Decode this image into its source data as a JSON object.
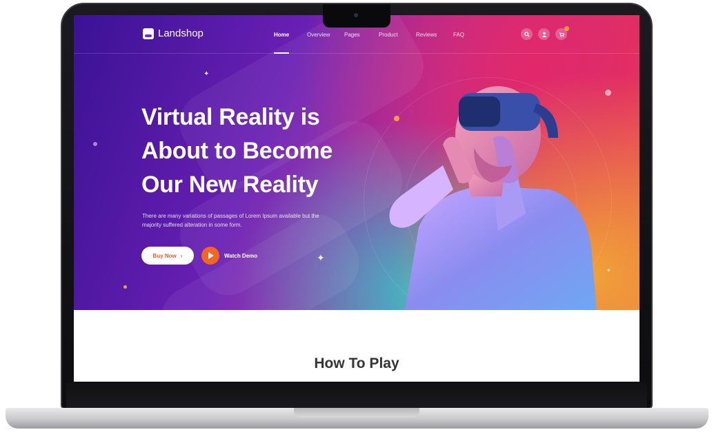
{
  "brand": {
    "name": "Landshop"
  },
  "nav": {
    "items": [
      {
        "label": "Home",
        "active": true
      },
      {
        "label": "Overview",
        "active": false
      },
      {
        "label": "Pages",
        "active": false
      },
      {
        "label": "Product",
        "active": false
      },
      {
        "label": "Reviews",
        "active": false
      },
      {
        "label": "FAQ",
        "active": false
      }
    ],
    "icons": [
      "search-icon",
      "user-icon",
      "cart-icon"
    ]
  },
  "hero": {
    "headline_lines": [
      "Virtual Reality is",
      "About to Become",
      "Our New Reality"
    ],
    "subtext_lines": [
      "There are many variations of passages of Lorem Ipsum available but the",
      "majority suffered alteration in some form."
    ],
    "buy_label": "Buy Now",
    "watch_label": "Watch Demo"
  },
  "section": {
    "title": "How To Play"
  },
  "colors": {
    "accent": "#f26522",
    "buy_text": "#f05a36",
    "hero_start": "#3a1295",
    "hero_end": "#ee6a3a"
  }
}
